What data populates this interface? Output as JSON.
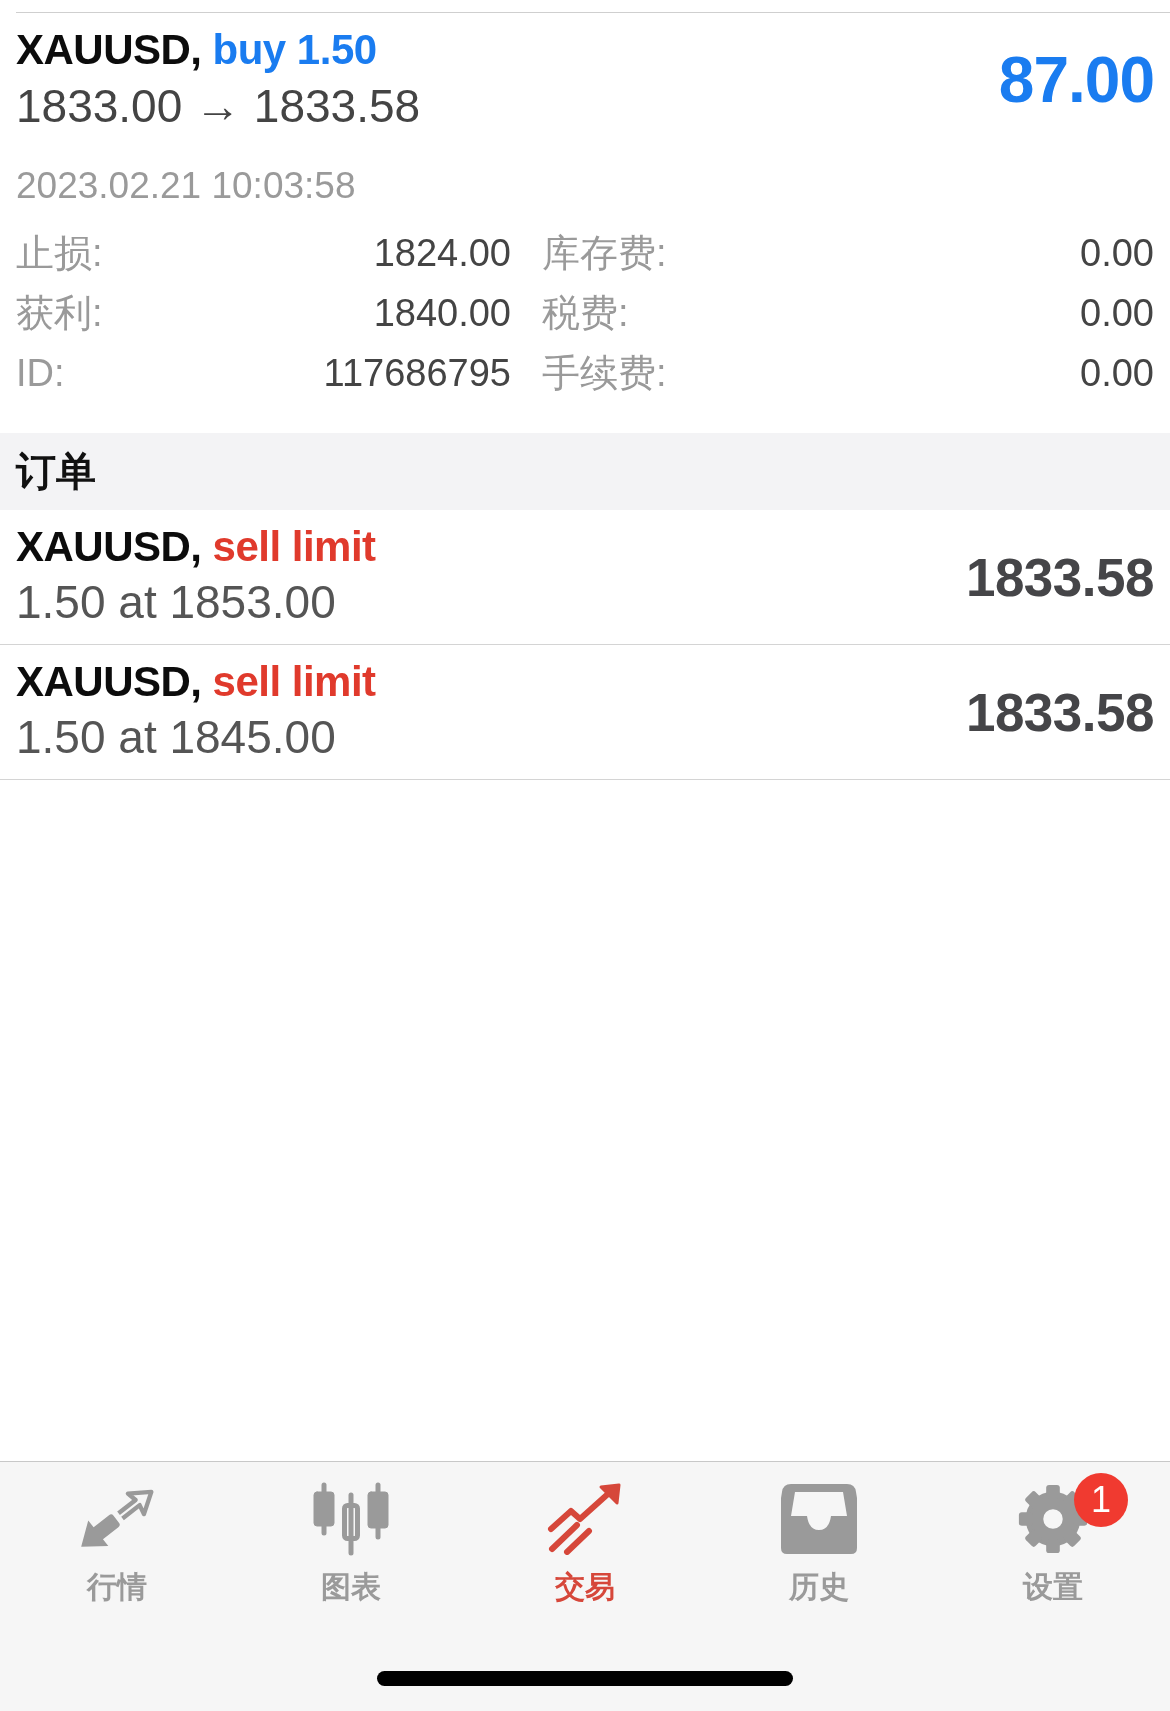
{
  "position": {
    "symbol": "XAUUSD,",
    "kind": "buy",
    "order_type": "buy 1.50",
    "prices": "1833.00 → 1833.58",
    "profit": "87.00",
    "time": "2023.02.21 10:03:58",
    "details": [
      {
        "label": "止损:",
        "value": "1824.00"
      },
      {
        "label": "库存费:",
        "value": "0.00"
      },
      {
        "label": "获利:",
        "value": "1840.00"
      },
      {
        "label": "税费:",
        "value": "0.00"
      },
      {
        "label": "ID:",
        "value": "117686795"
      },
      {
        "label": "手续费:",
        "value": "0.00"
      }
    ]
  },
  "orders_section": {
    "title": "订单",
    "orders": [
      {
        "symbol": "XAUUSD,",
        "kind": "sell",
        "order_type": "sell limit",
        "volume_price": "1.50 at 1853.00",
        "current_price": "1833.58"
      },
      {
        "symbol": "XAUUSD,",
        "kind": "sell",
        "order_type": "sell limit",
        "volume_price": "1.50 at 1845.00",
        "current_price": "1833.58"
      }
    ]
  },
  "tab_bar": {
    "tabs": [
      {
        "label": "行情",
        "selected": false
      },
      {
        "label": "图表",
        "selected": false
      },
      {
        "label": "交易",
        "selected": true
      },
      {
        "label": "历史",
        "selected": false
      },
      {
        "label": "设置",
        "selected": false,
        "badge": "1"
      }
    ]
  }
}
